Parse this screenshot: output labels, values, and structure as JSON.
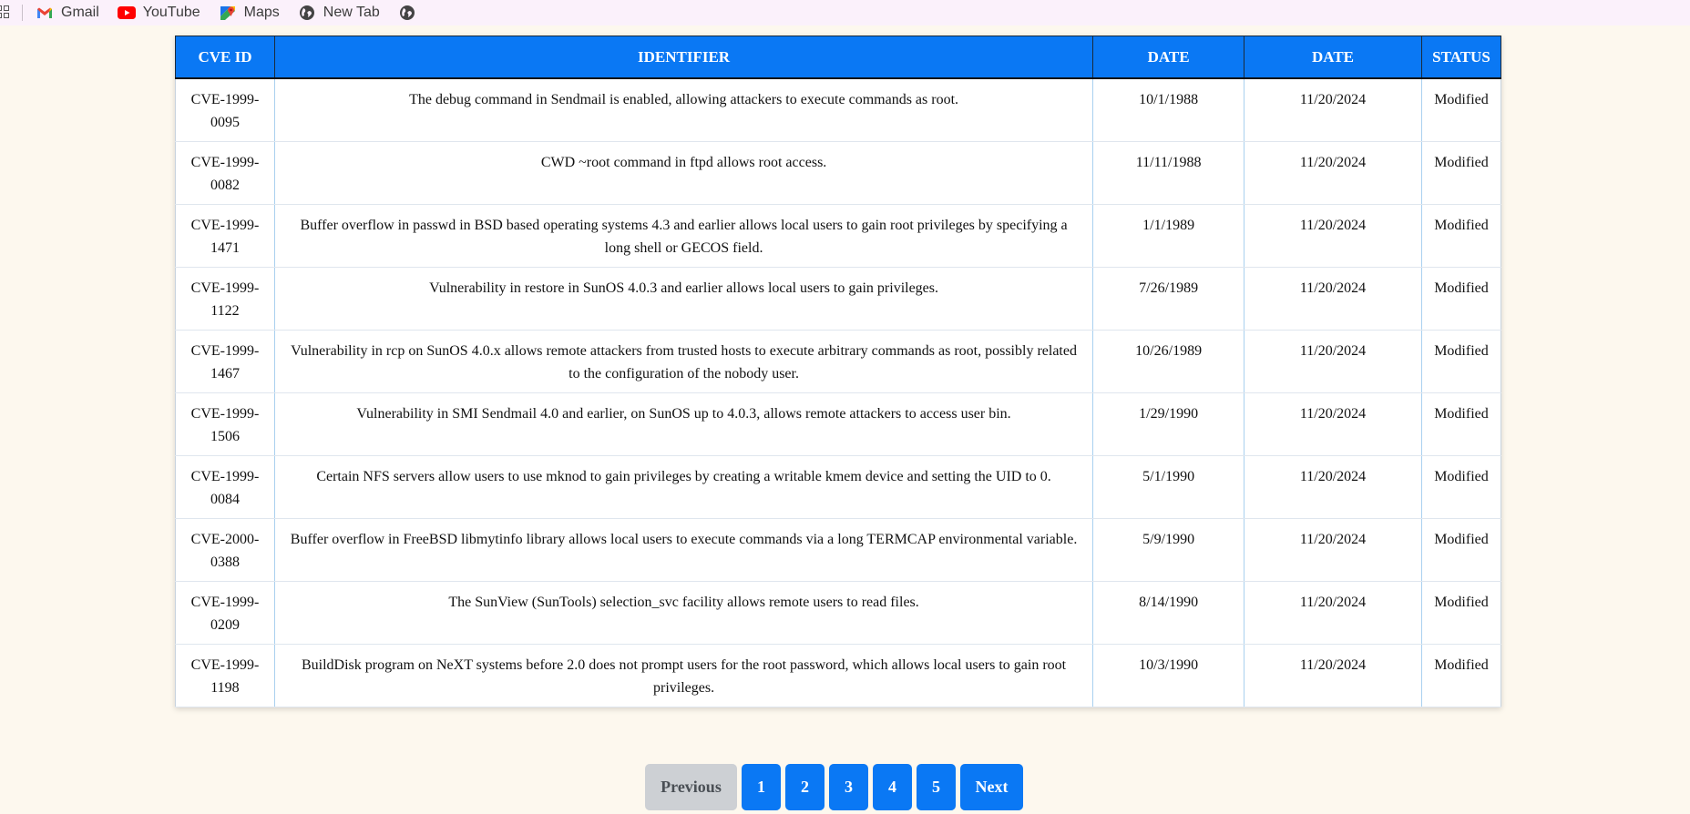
{
  "bookmarks": [
    {
      "label": "Gmail",
      "icon": "gmail-icon"
    },
    {
      "label": "YouTube",
      "icon": "youtube-icon"
    },
    {
      "label": "Maps",
      "icon": "maps-icon"
    },
    {
      "label": "New Tab",
      "icon": "globe-icon"
    }
  ],
  "table": {
    "headers": [
      "CVE ID",
      "IDENTIFIER",
      "DATE",
      "DATE",
      "STATUS"
    ],
    "rows": [
      {
        "id": "CVE-1999-0095",
        "identifier": "The debug command in Sendmail is enabled, allowing attackers to execute commands as root.",
        "date1": "10/1/1988",
        "date2": "11/20/2024",
        "status": "Modified"
      },
      {
        "id": "CVE-1999-0082",
        "identifier": "CWD ~root command in ftpd allows root access.",
        "date1": "11/11/1988",
        "date2": "11/20/2024",
        "status": "Modified"
      },
      {
        "id": "CVE-1999-1471",
        "identifier": "Buffer overflow in passwd in BSD based operating systems 4.3 and earlier allows local users to gain root privileges by specifying a long shell or GECOS field.",
        "date1": "1/1/1989",
        "date2": "11/20/2024",
        "status": "Modified"
      },
      {
        "id": "CVE-1999-1122",
        "identifier": "Vulnerability in restore in SunOS 4.0.3 and earlier allows local users to gain privileges.",
        "date1": "7/26/1989",
        "date2": "11/20/2024",
        "status": "Modified"
      },
      {
        "id": "CVE-1999-1467",
        "identifier": "Vulnerability in rcp on SunOS 4.0.x allows remote attackers from trusted hosts to execute arbitrary commands as root, possibly related to the configuration of the nobody user.",
        "date1": "10/26/1989",
        "date2": "11/20/2024",
        "status": "Modified"
      },
      {
        "id": "CVE-1999-1506",
        "identifier": "Vulnerability in SMI Sendmail 4.0 and earlier, on SunOS up to 4.0.3, allows remote attackers to access user bin.",
        "date1": "1/29/1990",
        "date2": "11/20/2024",
        "status": "Modified"
      },
      {
        "id": "CVE-1999-0084",
        "identifier": "Certain NFS servers allow users to use mknod to gain privileges by creating a writable kmem device and setting the UID to 0.",
        "date1": "5/1/1990",
        "date2": "11/20/2024",
        "status": "Modified"
      },
      {
        "id": "CVE-2000-0388",
        "identifier": "Buffer overflow in FreeBSD libmytinfo library allows local users to execute commands via a long TERMCAP environmental variable.",
        "date1": "5/9/1990",
        "date2": "11/20/2024",
        "status": "Modified"
      },
      {
        "id": "CVE-1999-0209",
        "identifier": "The SunView (SunTools) selection_svc facility allows remote users to read files.",
        "date1": "8/14/1990",
        "date2": "11/20/2024",
        "status": "Modified"
      },
      {
        "id": "CVE-1999-1198",
        "identifier": "BuildDisk program on NeXT systems before 2.0 does not prompt users for the root password, which allows local users to gain root privileges.",
        "date1": "10/3/1990",
        "date2": "11/20/2024",
        "status": "Modified"
      }
    ]
  },
  "pagination": {
    "previous": "Previous",
    "pages": [
      "1",
      "2",
      "3",
      "4",
      "5"
    ],
    "next": "Next"
  },
  "colors": {
    "accent": "#0a78f4",
    "page_background": "#fdf8ee",
    "bookmarks_background": "#fbf1fb",
    "disabled": "#cdd0d4"
  }
}
